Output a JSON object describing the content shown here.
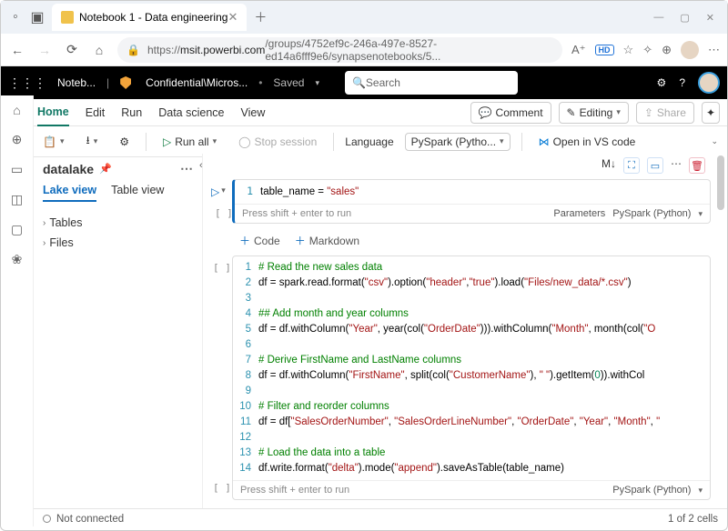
{
  "browser": {
    "tab_title": "Notebook 1 - Data engineering",
    "url_prefix": "https://",
    "url_host": "msit.powerbi.com",
    "url_path": "/groups/4752ef9c-246a-497e-8527-ed14a6fff9e6/synapsenotebooks/5..."
  },
  "fabric": {
    "workspace": "Noteb...",
    "sensitivity": "Confidential\\Micros...",
    "saved": "Saved",
    "search_placeholder": "Search"
  },
  "tabs": {
    "home": "Home",
    "edit": "Edit",
    "run": "Run",
    "data_science": "Data science",
    "view": "View",
    "comment": "Comment",
    "editing": "Editing",
    "share": "Share"
  },
  "toolbar": {
    "run_all": "Run all",
    "stop_session": "Stop session",
    "language_label": "Language",
    "language_value": "PySpark (Pytho...",
    "open_vs": "Open in VS code"
  },
  "sidebar": {
    "title": "datalake",
    "lake_view": "Lake view",
    "table_view": "Table view",
    "tables": "Tables",
    "files": "Files"
  },
  "cell1": {
    "line1_a": "table_name = ",
    "line1_b": "\"sales\"",
    "hint": "Press shift + enter to run",
    "parameters": "Parameters",
    "lang": "PySpark (Python)"
  },
  "add": {
    "code": "Code",
    "markdown": "Markdown"
  },
  "cell2": {
    "lines": [
      {
        "n": "1",
        "type": "cmt",
        "text": "# Read the new sales data"
      },
      {
        "n": "2",
        "type": "code",
        "html": "df = spark.read.format(<span class='c-str'>\"csv\"</span>).option(<span class='c-str'>\"header\"</span>,<span class='c-str'>\"true\"</span>).load(<span class='c-str'>\"Files/new_data/*.csv\"</span>)"
      },
      {
        "n": "3",
        "type": "blank",
        "text": ""
      },
      {
        "n": "4",
        "type": "cmt",
        "text": "## Add month and year columns"
      },
      {
        "n": "5",
        "type": "code",
        "html": "df = df.withColumn(<span class='c-str'>\"Year\"</span>, year(col(<span class='c-str'>\"OrderDate\"</span>))).withColumn(<span class='c-str'>\"Month\"</span>, month(col(<span class='c-str'>\"O"
      },
      {
        "n": "6",
        "type": "blank",
        "text": ""
      },
      {
        "n": "7",
        "type": "cmt",
        "text": "# Derive FirstName and LastName columns"
      },
      {
        "n": "8",
        "type": "code",
        "html": "df = df.withColumn(<span class='c-str'>\"FirstName\"</span>, split(col(<span class='c-str'>\"CustomerName\"</span>), <span class='c-str'>\" \"</span>).getItem(<span class='c-num'>0</span>)).withCol"
      },
      {
        "n": "9",
        "type": "blank",
        "text": ""
      },
      {
        "n": "10",
        "type": "cmt",
        "text": "# Filter and reorder columns"
      },
      {
        "n": "11",
        "type": "code",
        "html": "df = df[<span class='c-str'>\"SalesOrderNumber\"</span>, <span class='c-str'>\"SalesOrderLineNumber\"</span>, <span class='c-str'>\"OrderDate\"</span>, <span class='c-str'>\"Year\"</span>, <span class='c-str'>\"Month\"</span>, <span class='c-str'>\""
      },
      {
        "n": "12",
        "type": "blank",
        "text": ""
      },
      {
        "n": "13",
        "type": "cmt",
        "text": "# Load the data into a table"
      },
      {
        "n": "14",
        "type": "code",
        "html": "df.write.format(<span class='c-str'>\"delta\"</span>).mode(<span class='c-str'>\"append\"</span>).saveAsTable(table_name)"
      }
    ],
    "hint": "Press shift + enter to run",
    "lang": "PySpark (Python)"
  },
  "status": {
    "conn": "Not connected",
    "cells": "1 of 2 cells"
  }
}
